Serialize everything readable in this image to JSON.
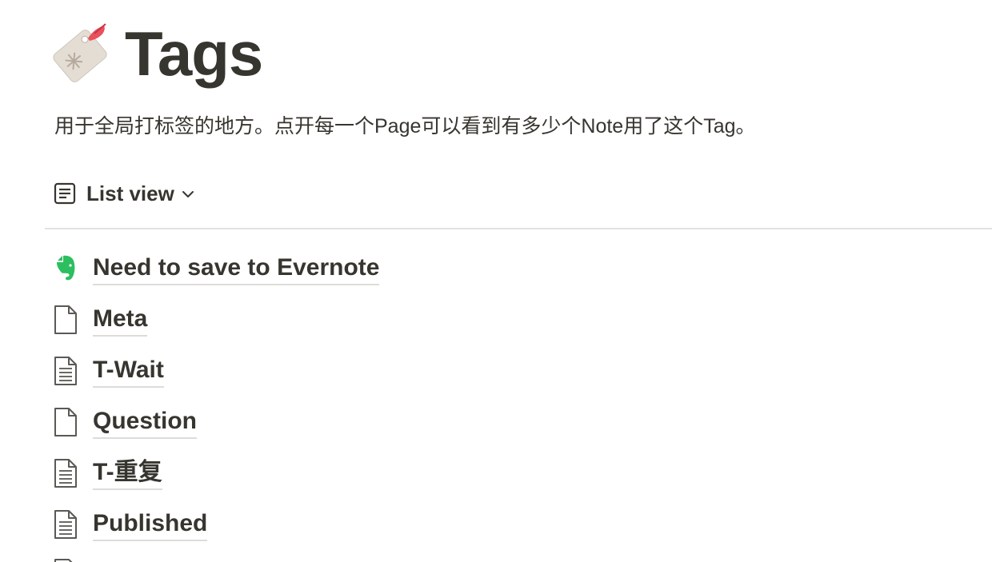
{
  "page": {
    "icon": "tag-emoji",
    "title": "Tags",
    "description": "用于全局打标签的地方。点开每一个Page可以看到有多少个Note用了这个Tag。"
  },
  "view": {
    "icon": "list-view-icon",
    "label": "List view",
    "chevron": "chevron-down-icon"
  },
  "items": [
    {
      "label": "Need to save to Evernote",
      "icon": "evernote-icon"
    },
    {
      "label": "Meta",
      "icon": "blank-page-icon"
    },
    {
      "label": "T-Wait",
      "icon": "text-page-icon"
    },
    {
      "label": "Question",
      "icon": "blank-page-icon"
    },
    {
      "label": "T-重复",
      "icon": "text-page-icon"
    },
    {
      "label": "Published",
      "icon": "text-page-icon"
    }
  ],
  "colors": {
    "text": "#37352f",
    "evernote": "#2dbe60",
    "divider": "#e3e2df"
  }
}
